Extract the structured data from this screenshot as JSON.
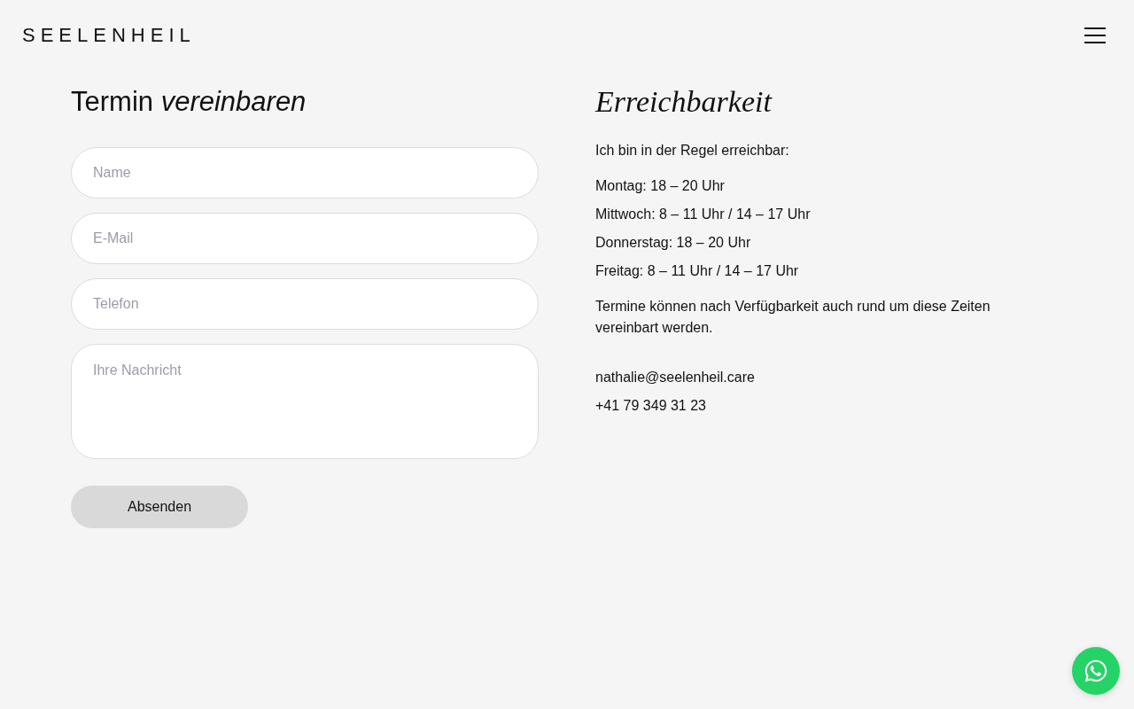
{
  "header": {
    "logo": "SEELENHEIL"
  },
  "contact_form": {
    "title": "Termin *vereinbaren*",
    "fields": [
      {
        "kind": "input",
        "placeholder": "Name"
      },
      {
        "kind": "input",
        "placeholder": "E-Mail"
      },
      {
        "kind": "input",
        "placeholder": "Telefon"
      },
      {
        "kind": "textarea",
        "placeholder": "Ihre Nachricht"
      }
    ],
    "submit_button": "Absenden"
  },
  "availability": {
    "title": "Erreichbarkeit",
    "intro": "Ich bin in der Regel erreichbar:",
    "hours": [
      "Montag: 18 – 20 Uhr",
      "Mittwoch: 8 – 11 Uhr / 14 – 17 Uhr",
      "Donnerstag: 18 – 20 Uhr",
      "Freitag: 8 – 11 Uhr / 14 – 17 Uhr"
    ],
    "note": "Termine können nach Verfügbarkeit auch rund um diese Zeiten vereinbart werden.",
    "email": "nathalie@seelenheil.care",
    "phone": "+41 79 349 31 23"
  }
}
